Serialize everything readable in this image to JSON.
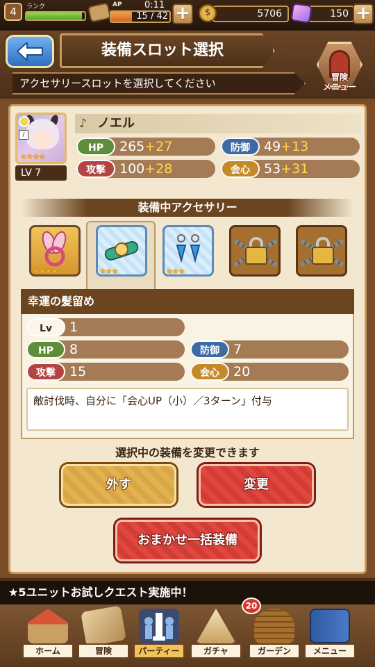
{
  "status_bar": {
    "rank_level": "4",
    "rank_label": "ランク",
    "rank_progress": 0.95,
    "ap_label": "AP",
    "ap_timer": "0:11",
    "ap_value": "15 / 42",
    "ap_progress": 0.36,
    "gold": "5706",
    "gems": "150",
    "plus": "+"
  },
  "header": {
    "title": "装備スロット選択",
    "subtitle": "アクセサリースロットを選択してください",
    "adventure_menu_label": "冒険\nメニュー"
  },
  "character": {
    "name": "ノエル",
    "level": "LV 7",
    "stars": "★★★★",
    "stats": {
      "hp_label": "HP",
      "hp_value": "265",
      "hp_bonus": "+27",
      "def_label": "防御",
      "def_value": "49",
      "def_bonus": "+13",
      "atk_label": "攻撃",
      "atk_value": "100",
      "atk_bonus": "+28",
      "crit_label": "会心",
      "crit_value": "53",
      "crit_bonus": "+31"
    }
  },
  "accessories": {
    "heading": "装備中アクセサリー",
    "slots": [
      {
        "stars": "★★★★"
      },
      {
        "stars": "★★★"
      },
      {
        "stars": "★★★"
      }
    ]
  },
  "selected_item": {
    "name": "幸運の髪留め",
    "lv_label": "Lv",
    "lv_value": "1",
    "hp_label": "HP",
    "hp_value": "8",
    "def_label": "防御",
    "def_value": "7",
    "atk_label": "攻撃",
    "atk_value": "15",
    "crit_label": "会心",
    "crit_value": "20",
    "effect": "敵討伐時、自分に「会心UP（小）／3ターン」付与"
  },
  "actions": {
    "note": "選択中の装備を変更できます",
    "remove": "外す",
    "change": "変更",
    "auto_equip": "おまかせ一括装備"
  },
  "ticker": "★5ユニットお試しクエスト実施中！",
  "nav": {
    "home": "ホーム",
    "adventure": "冒険",
    "party": "パーティー",
    "gacha": "ガチャ",
    "garden": "ガーデン",
    "menu": "メニュー",
    "garden_badge": "20"
  },
  "colors": {
    "hp": "#5f8e3a",
    "defense": "#3d6aa0",
    "attack": "#b24444",
    "crit": "#c48a2a",
    "bonus": "#ffd94a"
  }
}
